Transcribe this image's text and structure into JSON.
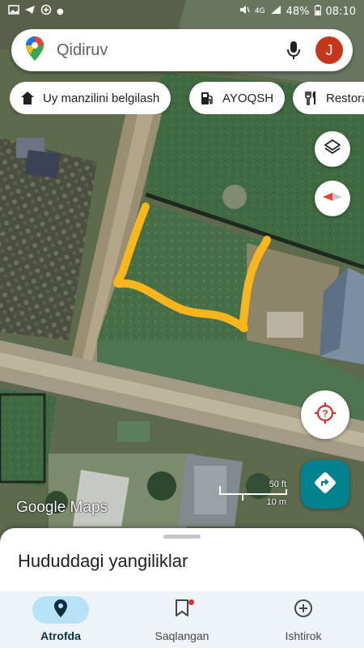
{
  "status_bar": {
    "battery": "48%",
    "time": "08:10",
    "network": "4G"
  },
  "search": {
    "placeholder": "Qidiruv",
    "avatar_letter": "J"
  },
  "chips": [
    {
      "label": "Uy manzilini belgilash",
      "icon": "home-icon"
    },
    {
      "label": "AYOQSH",
      "icon": "gas-station-icon"
    },
    {
      "label": "Restora",
      "icon": "restaurant-icon"
    }
  ],
  "map": {
    "watermark": "Google Maps",
    "scale_ft": "50 ft",
    "scale_m": "10 m",
    "annotation_color": "#f9b51c"
  },
  "sheet": {
    "title": "Hududdagi yangiliklar"
  },
  "nav": {
    "items": [
      {
        "label": "Atrofda",
        "icon": "location-pin-icon",
        "active": true
      },
      {
        "label": "Saqlangan",
        "icon": "bookmark-icon",
        "active": false
      },
      {
        "label": "Ishtirok",
        "icon": "add-circle-icon",
        "active": false
      }
    ]
  },
  "colors": {
    "accent": "#00838f",
    "avatar": "#c6361b",
    "active_nav": "#b6e3f8"
  }
}
